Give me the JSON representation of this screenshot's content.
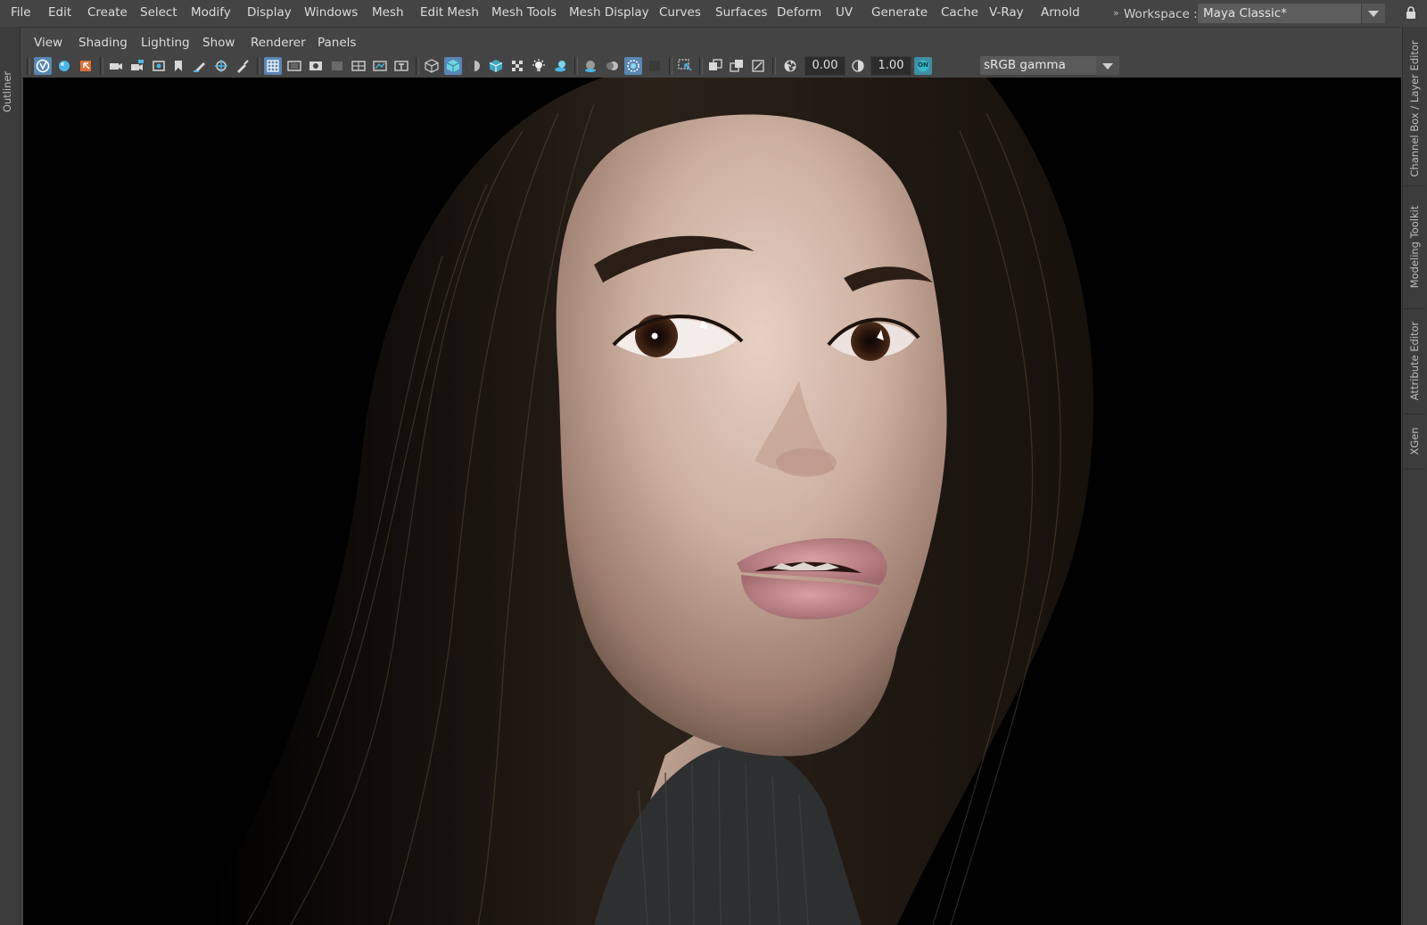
{
  "main_menu": [
    "File",
    "Edit",
    "Create",
    "Select",
    "Modify",
    "Display",
    "Windows",
    "Mesh",
    "Edit Mesh",
    "Mesh Tools",
    "Mesh Display",
    "Curves",
    "Surfaces",
    "Deform",
    "UV",
    "Generate",
    "Cache",
    "V-Ray",
    "Arnold"
  ],
  "workspace": {
    "label": "Workspace :",
    "value": "Maya Classic*"
  },
  "left_tabs": [
    "Outliner"
  ],
  "right_tabs": [
    "Channel Box / Layer Editor",
    "Modeling Toolkit",
    "Attribute Editor",
    "XGen"
  ],
  "panel_menu": [
    "View",
    "Shading",
    "Lighting",
    "Show",
    "Renderer",
    "Panels"
  ],
  "toolbar": {
    "exposure": "0.00",
    "gamma": "1.00",
    "color_space": "sRGB gamma",
    "cm_badge": "ON"
  },
  "viewport": {
    "content": "3D render of a woman with long dark hair looking over her shoulder, wearing a dark turtleneck, against black background"
  },
  "colors": {
    "ui_bg": "#444444",
    "active_blue": "#5a86b4",
    "viewport_bg": "#000000",
    "accent_teal": "#35b6c8"
  }
}
